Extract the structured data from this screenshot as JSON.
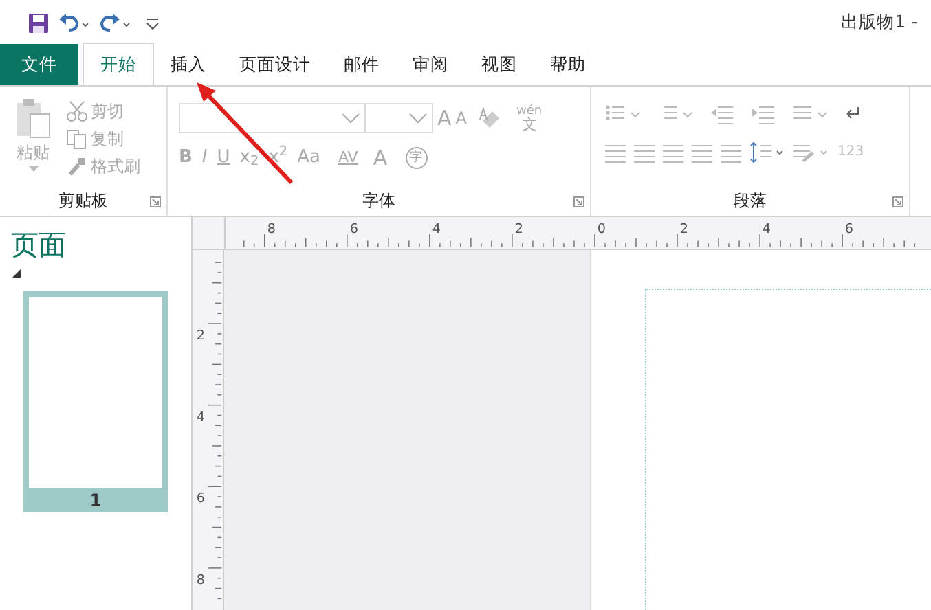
{
  "title_bar": {
    "document_title": "出版物1 -"
  },
  "tabs": [
    {
      "label": "文件",
      "kind": "file",
      "selected": false
    },
    {
      "label": "开始",
      "kind": "tab",
      "selected": true
    },
    {
      "label": "插入",
      "kind": "tab",
      "selected": false
    },
    {
      "label": "页面设计",
      "kind": "tab",
      "selected": false
    },
    {
      "label": "邮件",
      "kind": "tab",
      "selected": false
    },
    {
      "label": "审阅",
      "kind": "tab",
      "selected": false
    },
    {
      "label": "视图",
      "kind": "tab",
      "selected": false
    },
    {
      "label": "帮助",
      "kind": "tab",
      "selected": false
    }
  ],
  "clipboard": {
    "label": "剪贴板",
    "paste": {
      "label": "粘贴",
      "disabled": true
    },
    "items": [
      {
        "label": "剪切",
        "disabled": true
      },
      {
        "label": "复制",
        "disabled": true
      },
      {
        "label": "格式刷",
        "disabled": true
      }
    ]
  },
  "font": {
    "label": "字体",
    "grow": "A",
    "shrink": "A",
    "phonetic_top": "wén",
    "phonetic_bottom": "文",
    "buttons": [
      "B",
      "I",
      "U",
      "x$_{2}$",
      "x$^{2}$",
      "Aa"
    ],
    "spacing": "AV",
    "font_color": "A",
    "enclose": "字",
    "disabled": true
  },
  "paragraph": {
    "label": "段落",
    "numbers": "123",
    "disabled": true
  },
  "pages_panel": {
    "title": "页面",
    "pages": [
      {
        "number": "1",
        "selected": true
      }
    ]
  },
  "rulers": {
    "horizontal": [
      "8",
      "6",
      "4",
      "2",
      "0",
      "2",
      "4",
      "6"
    ],
    "vertical": [
      "2",
      "4",
      "6",
      "8"
    ]
  }
}
